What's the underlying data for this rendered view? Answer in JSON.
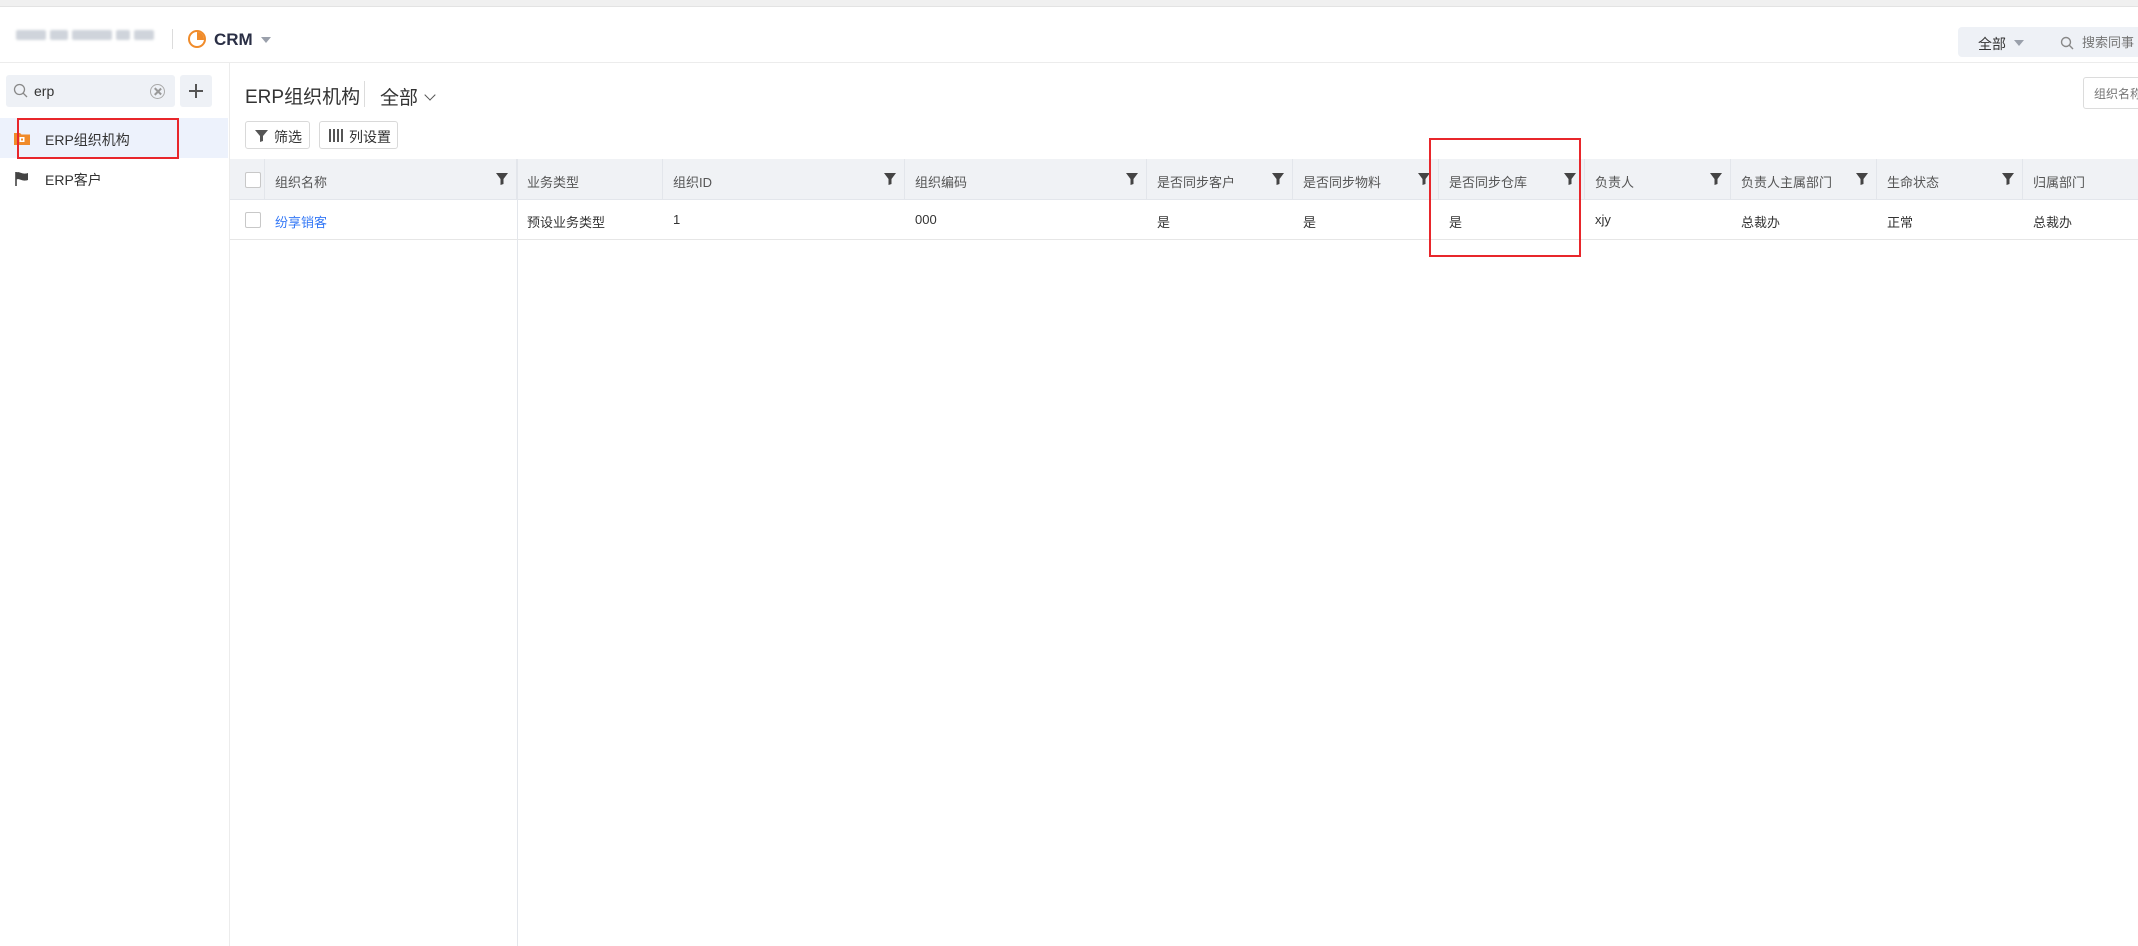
{
  "topbar": {
    "company_name": "",
    "app_name": "CRM",
    "scope_label": "全部",
    "search_placeholder": "搜索同事"
  },
  "sidebar": {
    "search_value": "erp",
    "items": [
      {
        "label": "ERP组织机构",
        "active": true,
        "icon": "org-folder-icon"
      },
      {
        "label": "ERP客户",
        "active": false,
        "icon": "flag-icon"
      }
    ]
  },
  "main": {
    "title": "ERP组织机构",
    "view": "全部",
    "search_placeholder": "组织名称",
    "toolbar": {
      "filter_label": "筛选",
      "columns_label": "列设置"
    }
  },
  "table": {
    "columns": [
      "组织名称",
      "业务类型",
      "组织ID",
      "组织编码",
      "是否同步客户",
      "是否同步物料",
      "是否同步仓库",
      "负责人",
      "负责人主属部门",
      "生命状态",
      "归属部门"
    ],
    "rows": [
      [
        "纷享销客",
        "预设业务类型",
        "1",
        "000",
        "是",
        "是",
        "是",
        "xjy",
        "总裁办",
        "正常",
        "总裁办"
      ]
    ]
  },
  "colors": {
    "accent": "#3478f6",
    "brand_orange": "#f08b2a",
    "highlight_red": "#e8262b"
  }
}
